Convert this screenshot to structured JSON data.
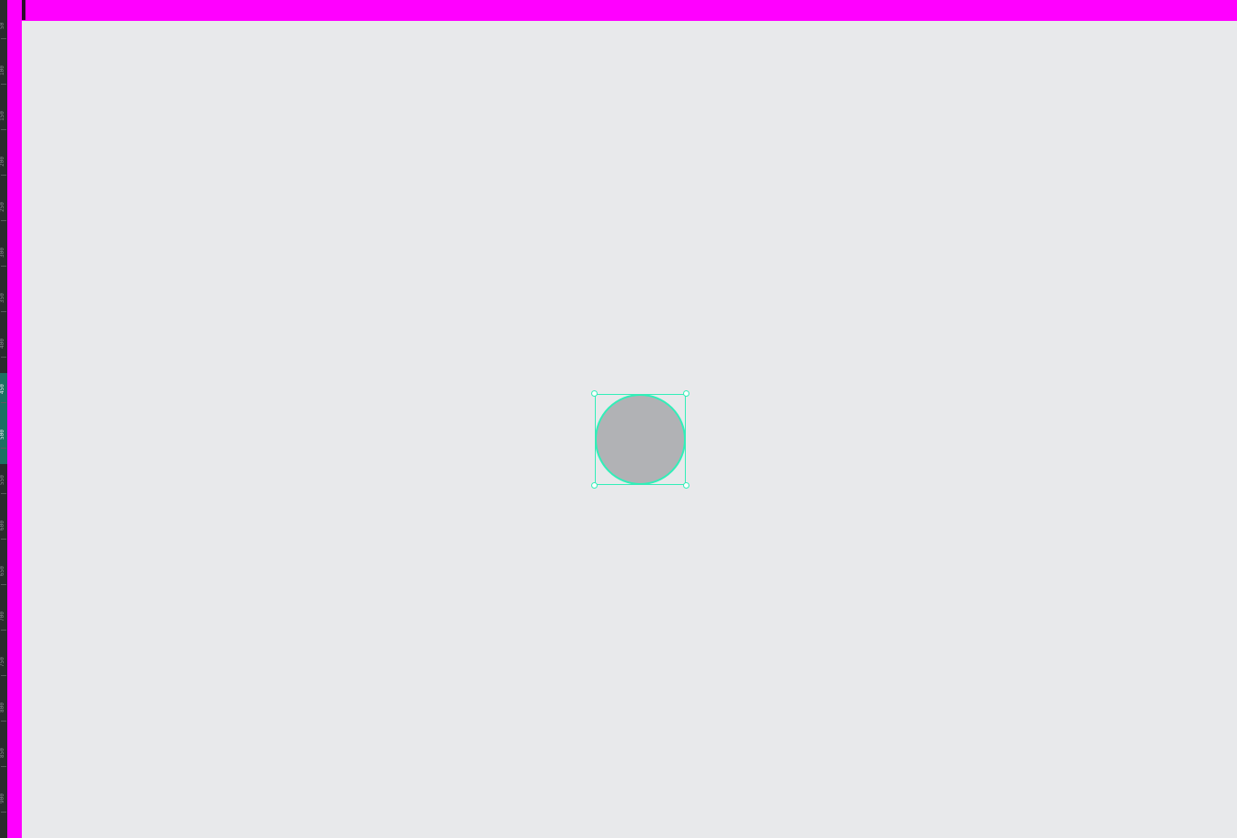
{
  "colors": {
    "canvas_background": "#e8e9eb",
    "frame_guide": "#ff00ff",
    "selection_accent": "#31efb8",
    "shape_fill": "#b1b2b5",
    "ruler_background": "#2b2b2e"
  },
  "ruler_left": {
    "labels": [
      "50",
      "100",
      "150",
      "200",
      "250",
      "300",
      "350",
      "400",
      "450",
      "500",
      "550",
      "600",
      "650",
      "700",
      "750",
      "800",
      "850",
      "900"
    ]
  },
  "canvas": {
    "selected_shape": {
      "type": "ellipse",
      "selected": true
    }
  },
  "icons": {
    "handle": "resize-handle-icon"
  }
}
